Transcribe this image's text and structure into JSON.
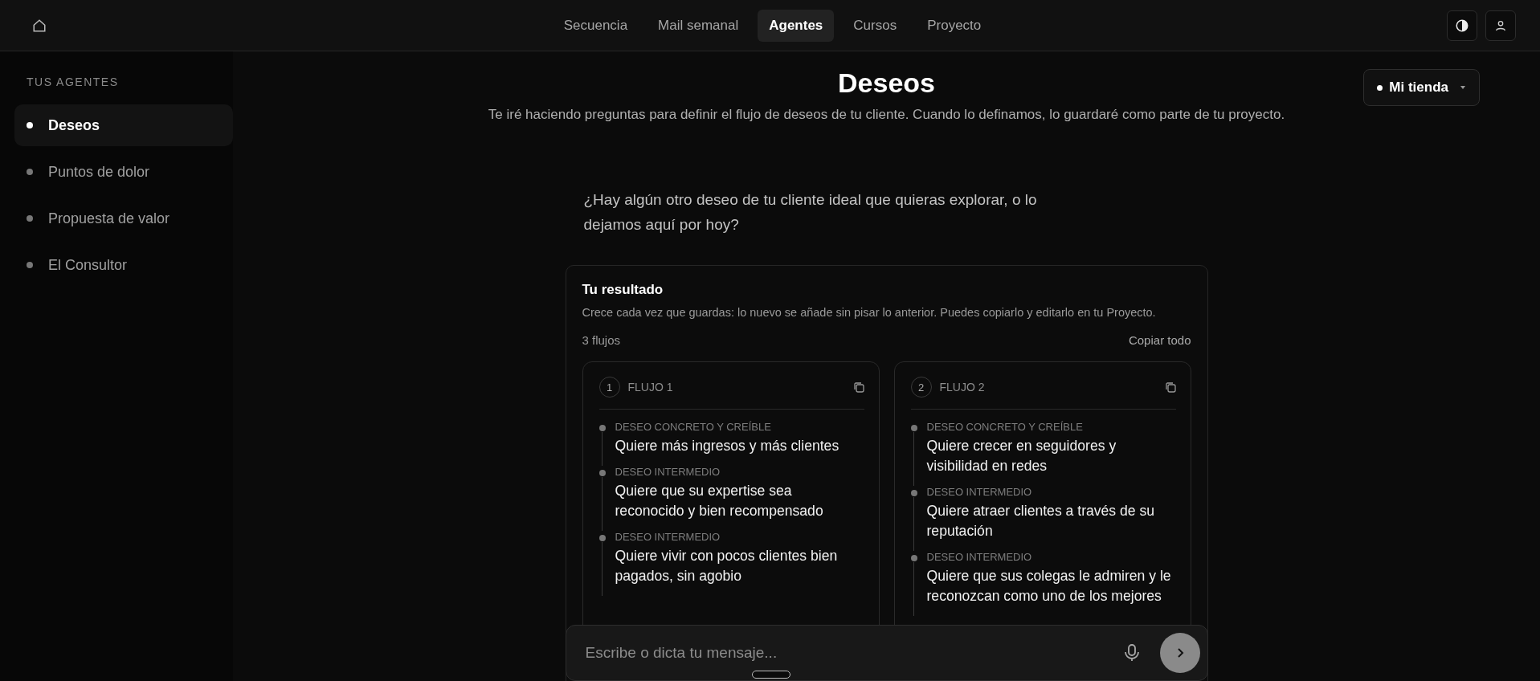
{
  "nav": {
    "tabs": [
      {
        "label": "Secuencia",
        "selected": false
      },
      {
        "label": "Mail semanal",
        "selected": false
      },
      {
        "label": "Agentes",
        "selected": true
      },
      {
        "label": "Cursos",
        "selected": false
      },
      {
        "label": "Proyecto",
        "selected": false
      }
    ]
  },
  "sidebar": {
    "heading": "TUS AGENTES",
    "items": [
      {
        "label": "Deseos",
        "selected": true
      },
      {
        "label": "Puntos de dolor",
        "selected": false
      },
      {
        "label": "Propuesta de valor",
        "selected": false
      },
      {
        "label": "El Consultor",
        "selected": false
      }
    ]
  },
  "header": {
    "title": "Deseos",
    "subtitle": "Te iré haciendo preguntas para definir el flujo de deseos de tu cliente. Cuando lo definamos, lo guardaré como parte de tu proyecto.",
    "store": "Mi tienda"
  },
  "chat": {
    "message": "¿Hay algún otro deseo de tu cliente ideal que quieras explorar, o lo dejamos aquí por hoy?"
  },
  "result": {
    "title": "Tu resultado",
    "description": "Crece cada vez que guardas: lo nuevo se añade sin pisar lo anterior. Puedes copiarlo y editarlo en tu Proyecto.",
    "count": "3 flujos",
    "copy_all": "Copiar todo",
    "flows": [
      {
        "number": "1",
        "title": "FLUJO 1",
        "steps": [
          {
            "label": "DESEO CONCRETO Y CREÍBLE",
            "text": "Quiere más ingresos y más clientes"
          },
          {
            "label": "DESEO INTERMEDIO",
            "text": "Quiere que su expertise sea reconocido y bien recompensado"
          },
          {
            "label": "DESEO INTERMEDIO",
            "text": "Quiere vivir con pocos clientes bien pagados, sin agobio"
          }
        ]
      },
      {
        "number": "2",
        "title": "FLUJO 2",
        "steps": [
          {
            "label": "DESEO CONCRETO Y CREÍBLE",
            "text": "Quiere crecer en seguidores y visibilidad en redes"
          },
          {
            "label": "DESEO INTERMEDIO",
            "text": "Quiere atraer clientes a través de su reputación"
          },
          {
            "label": "DESEO INTERMEDIO",
            "text": "Quiere que sus colegas le admiren y le reconozcan como uno de los mejores"
          }
        ]
      }
    ]
  },
  "composer": {
    "placeholder": "Escribe o dicta tu mensaje..."
  }
}
